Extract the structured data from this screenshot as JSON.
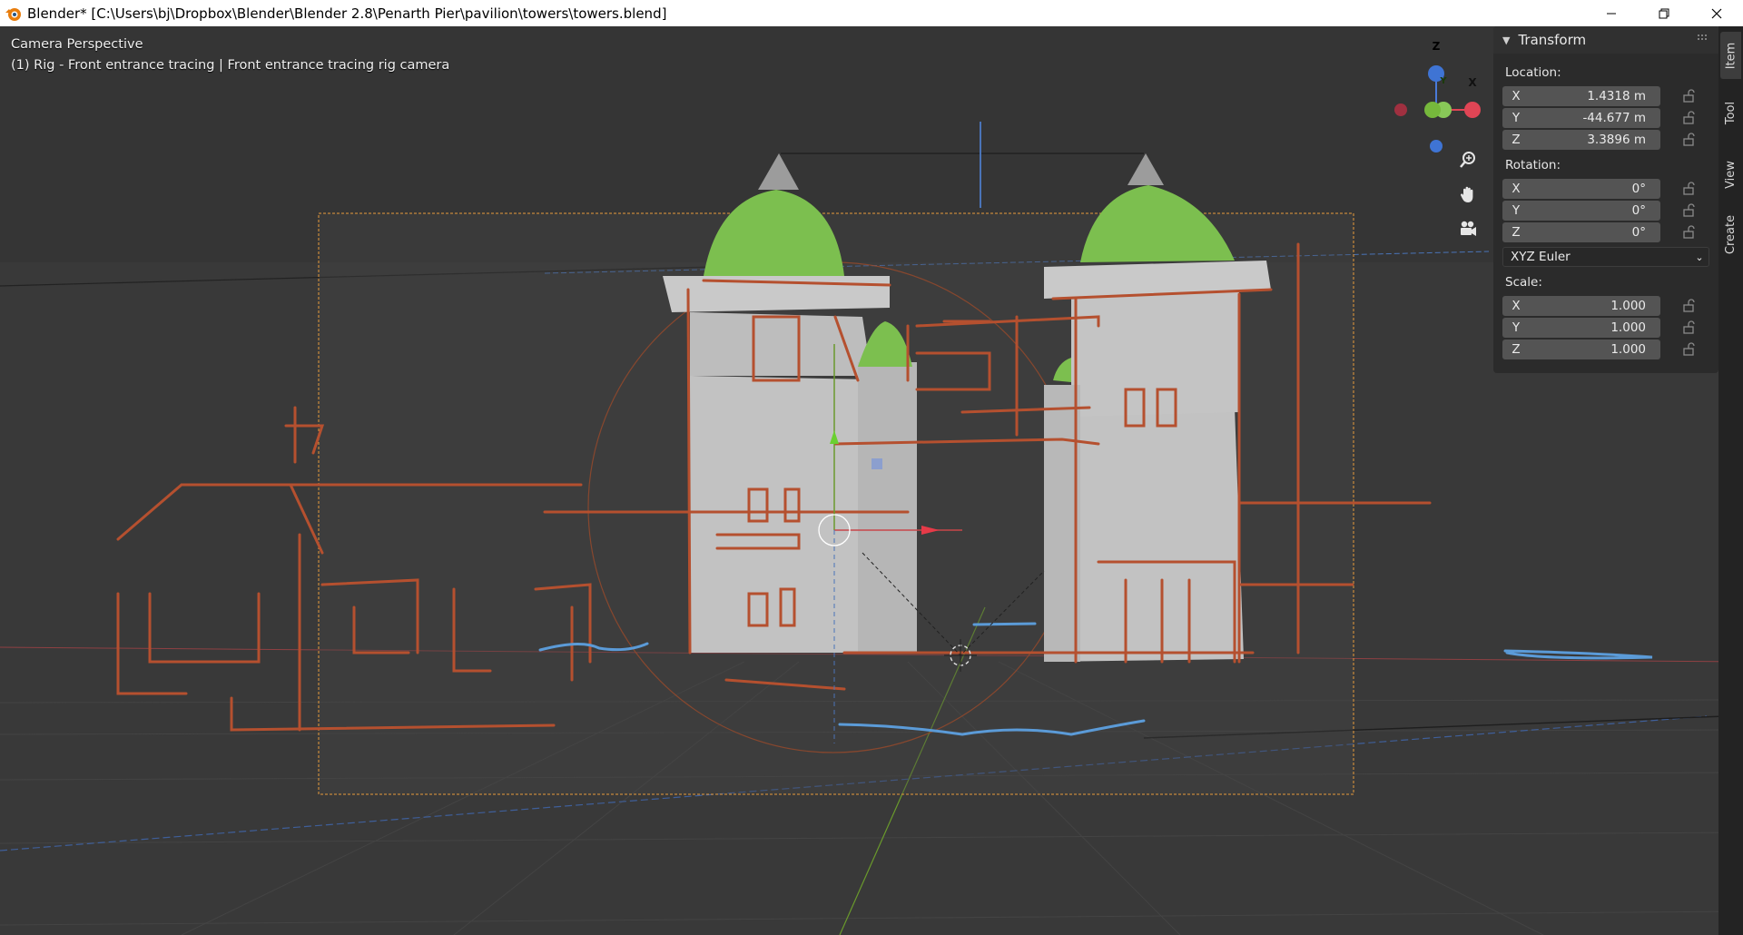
{
  "window": {
    "title": "Blender* [C:\\Users\\bj\\Dropbox\\Blender\\Blender 2.8\\Penarth Pier\\pavilion\\towers\\towers.blend]",
    "buttons": [
      "minimize-icon",
      "restore-icon",
      "close-icon"
    ]
  },
  "viewport": {
    "view_name": "Camera Perspective",
    "object_info": "(1) Rig - Front entrance tracing | Front entrance tracing rig camera",
    "gizmo": {
      "z_label": "Z",
      "x_label": "X",
      "y_label": "Y"
    },
    "nav_icons": [
      "zoom-icon",
      "hand-pan-icon",
      "camera-view-icon"
    ],
    "colors": {
      "background": "#393939",
      "grid_line": "#444444",
      "x_axis": "#c8464a",
      "y_axis": "#6a9a2c",
      "camera_frame": "#e89a3a",
      "sketch": "#b5502f",
      "water_sketch": "#5b9bd8",
      "dome": "#7cbf4f",
      "tower": "#c2c2c2"
    }
  },
  "sidebar": {
    "panel_title": "Transform",
    "location": {
      "label": "Location:",
      "x": {
        "axis": "X",
        "value": "1.4318 m"
      },
      "y": {
        "axis": "Y",
        "value": "-44.677 m"
      },
      "z": {
        "axis": "Z",
        "value": "3.3896 m"
      }
    },
    "rotation": {
      "label": "Rotation:",
      "x": {
        "axis": "X",
        "value": "0°"
      },
      "y": {
        "axis": "Y",
        "value": "0°"
      },
      "z": {
        "axis": "Z",
        "value": "0°"
      },
      "mode": "XYZ Euler"
    },
    "scale": {
      "label": "Scale:",
      "x": {
        "axis": "X",
        "value": "1.000"
      },
      "y": {
        "axis": "Y",
        "value": "1.000"
      },
      "z": {
        "axis": "Z",
        "value": "1.000"
      }
    },
    "tabs": [
      "Item",
      "Tool",
      "View",
      "Create"
    ],
    "active_tab": "Item"
  }
}
